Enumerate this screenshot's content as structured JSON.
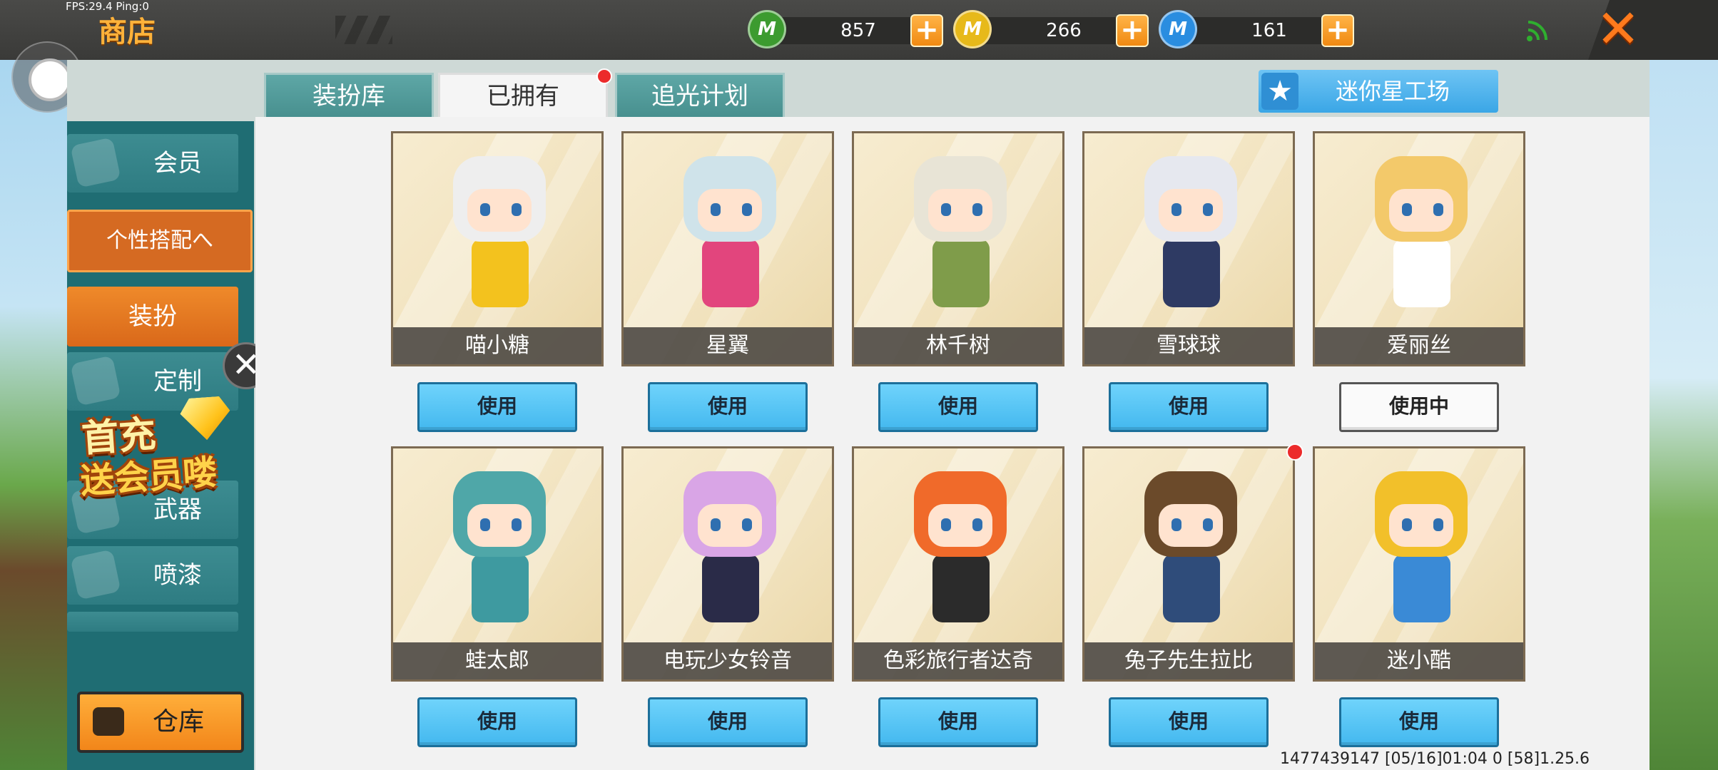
{
  "debug": {
    "fps_text": "FPS:29.4  Ping:0"
  },
  "header": {
    "title": "商店",
    "currencies": [
      {
        "icon": "green-coin-icon",
        "letter": "M",
        "value": "857",
        "color": "#3c9b2f"
      },
      {
        "icon": "gold-coin-icon",
        "letter": "M",
        "value": "266",
        "color": "#e7b91a"
      },
      {
        "icon": "blue-coin-icon",
        "letter": "M",
        "value": "161",
        "color": "#2a8de0"
      }
    ],
    "plus_label": "+",
    "close_label": "✕"
  },
  "tabs": [
    {
      "label": "装扮库",
      "active": false
    },
    {
      "label": "已拥有",
      "active": true,
      "badge": true
    },
    {
      "label": "追光计划",
      "active": false
    }
  ],
  "workshop_label": "迷你星工场",
  "sidebar": {
    "items": [
      {
        "label": "会员"
      },
      {
        "label": "个性搭配へ"
      },
      {
        "label": "装扮"
      },
      {
        "label": "定制"
      },
      {
        "label": "武器"
      },
      {
        "label": "喷漆"
      }
    ],
    "warehouse_label": "仓库",
    "close_label": "✕"
  },
  "promo": {
    "line1": "首充",
    "line2": "送会员喽"
  },
  "skins": [
    {
      "name": "喵小糖",
      "action": "使用",
      "hair": "#eeeeee",
      "body": "#f3c21e"
    },
    {
      "name": "星翼",
      "action": "使用",
      "hair": "#cfe3ea",
      "body": "#e2457d"
    },
    {
      "name": "林千树",
      "action": "使用",
      "hair": "#e8e4d6",
      "body": "#7f9c4a"
    },
    {
      "name": "雪球球",
      "action": "使用",
      "hair": "#e6e8ef",
      "body": "#2e3a63"
    },
    {
      "name": "爱丽丝",
      "action": "使用中",
      "hair": "#f3c96a",
      "body": "#ffffff"
    },
    {
      "name": "蛙太郎",
      "action": "使用",
      "hair": "#4fa7a8",
      "body": "#3e9aa0"
    },
    {
      "name": "电玩少女铃音",
      "action": "使用",
      "hair": "#d9a5e6",
      "body": "#2a2b48"
    },
    {
      "name": "色彩旅行者达奇",
      "action": "使用",
      "hair": "#f06a2a",
      "body": "#2b2b2b"
    },
    {
      "name": "兔子先生拉比",
      "action": "使用",
      "hair": "#6b4a2a",
      "body": "#2f4c7a",
      "badge": true
    },
    {
      "name": "迷小酷",
      "action": "使用",
      "hair": "#f2c02a",
      "body": "#3a8ad6"
    }
  ],
  "footer": "1477439147   [05/16]01:04 0   [58]1.25.6"
}
